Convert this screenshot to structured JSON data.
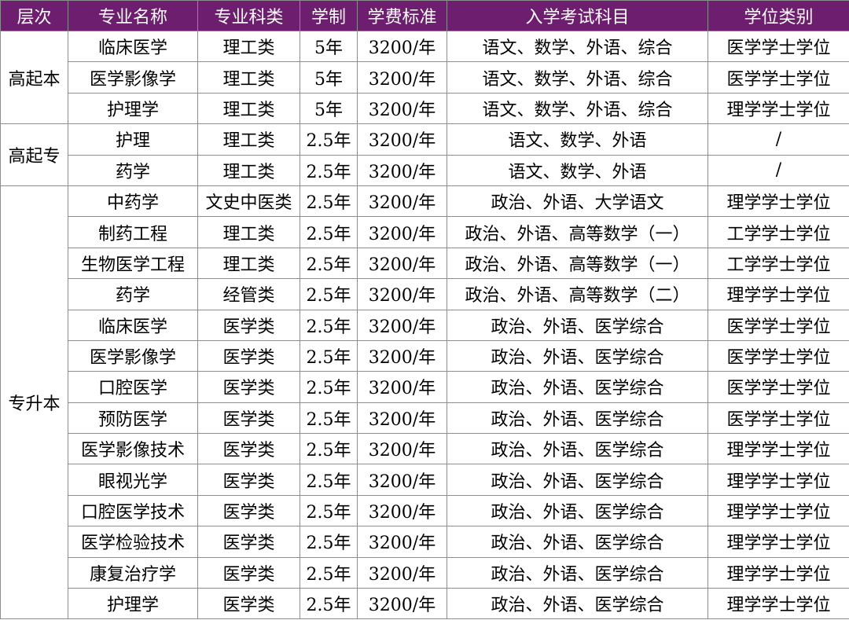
{
  "headers": [
    "层次",
    "专业名称",
    "专业科类",
    "学制",
    "学费标准",
    "入学考试科目",
    "学位类别"
  ],
  "groups": [
    {
      "level": "高起本",
      "rows": [
        [
          "临床医学",
          "理工类",
          "5年",
          "3200/年",
          "语文、数学、外语、综合",
          "医学学士学位"
        ],
        [
          "医学影像学",
          "理工类",
          "5年",
          "3200/年",
          "语文、数学、外语、综合",
          "医学学士学位"
        ],
        [
          "护理学",
          "理工类",
          "5年",
          "3200/年",
          "语文、数学、外语、综合",
          "理学学士学位"
        ]
      ]
    },
    {
      "level": "高起专",
      "rows": [
        [
          "护理",
          "理工类",
          "2.5年",
          "3200/年",
          "语文、数学、外语",
          "/"
        ],
        [
          "药学",
          "理工类",
          "2.5年",
          "3200/年",
          "语文、数学、外语",
          "/"
        ]
      ]
    },
    {
      "level": "专升本",
      "rows": [
        [
          "中药学",
          "文史中医类",
          "2.5年",
          "3200/年",
          "政治、外语、大学语文",
          "理学学士学位"
        ],
        [
          "制药工程",
          "理工类",
          "2.5年",
          "3200/年",
          "政治、外语、高等数学（一）",
          "工学学士学位"
        ],
        [
          "生物医学工程",
          "理工类",
          "2.5年",
          "3200/年",
          "政治、外语、高等数学（一）",
          "工学学士学位"
        ],
        [
          "药学",
          "经管类",
          "2.5年",
          "3200/年",
          "政治、外语、高等数学（二）",
          "理学学士学位"
        ],
        [
          "临床医学",
          "医学类",
          "2.5年",
          "3200/年",
          "政治、外语、医学综合",
          "医学学士学位"
        ],
        [
          "医学影像学",
          "医学类",
          "2.5年",
          "3200/年",
          "政治、外语、医学综合",
          "医学学士学位"
        ],
        [
          "口腔医学",
          "医学类",
          "2.5年",
          "3200/年",
          "政治、外语、医学综合",
          "医学学士学位"
        ],
        [
          "预防医学",
          "医学类",
          "2.5年",
          "3200/年",
          "政治、外语、医学综合",
          "医学学士学位"
        ],
        [
          "医学影像技术",
          "医学类",
          "2.5年",
          "3200/年",
          "政治、外语、医学综合",
          "理学学士学位"
        ],
        [
          "眼视光学",
          "医学类",
          "2.5年",
          "3200/年",
          "政治、外语、医学综合",
          "理学学士学位"
        ],
        [
          "口腔医学技术",
          "医学类",
          "2.5年",
          "3200/年",
          "政治、外语、医学综合",
          "理学学士学位"
        ],
        [
          "医学检验技术",
          "医学类",
          "2.5年",
          "3200/年",
          "政治、外语、医学综合",
          "理学学士学位"
        ],
        [
          "康复治疗学",
          "医学类",
          "2.5年",
          "3200/年",
          "政治、外语、医学综合",
          "理学学士学位"
        ],
        [
          "护理学",
          "医学类",
          "2.5年",
          "3200/年",
          "政治、外语、医学综合",
          "理学学士学位"
        ]
      ]
    }
  ]
}
